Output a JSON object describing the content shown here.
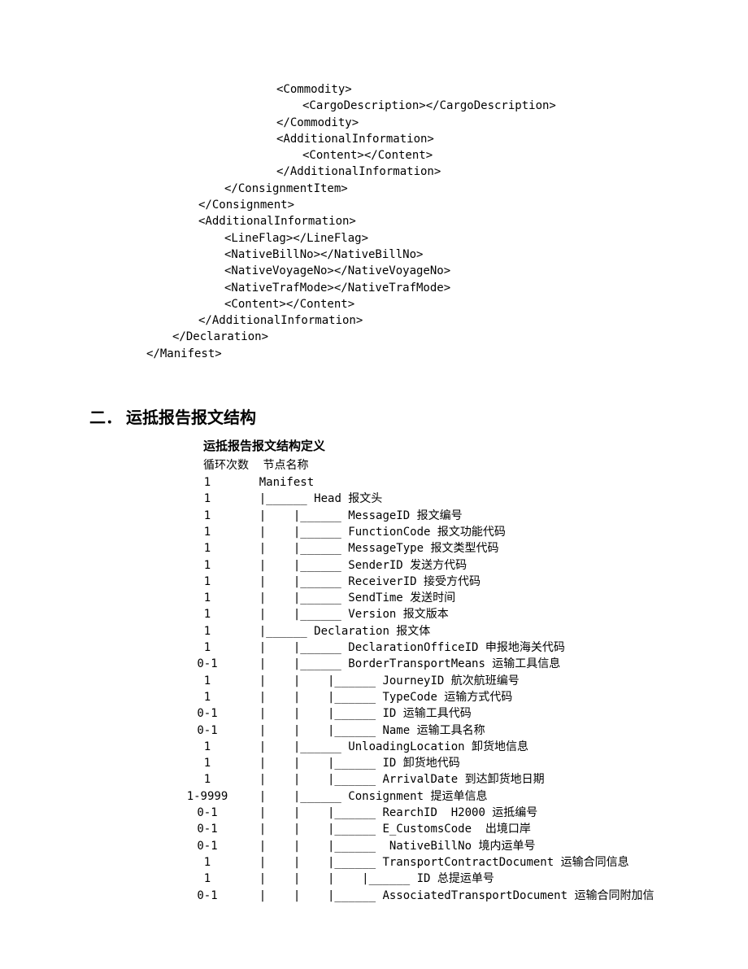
{
  "xml_lines": [
    {
      "indent": 5,
      "text": "<Commodity>"
    },
    {
      "indent": 6,
      "text": "<CargoDescription></CargoDescription>"
    },
    {
      "indent": 5,
      "text": "</Commodity>"
    },
    {
      "indent": 5,
      "text": "<AdditionalInformation>"
    },
    {
      "indent": 6,
      "text": "<Content></Content>"
    },
    {
      "indent": 5,
      "text": "</AdditionalInformation>"
    },
    {
      "indent": 3,
      "text": "</ConsignmentItem>"
    },
    {
      "indent": 2,
      "text": "</Consignment>"
    },
    {
      "indent": 2,
      "text": "<AdditionalInformation>"
    },
    {
      "indent": 3,
      "text": "<LineFlag></LineFlag>"
    },
    {
      "indent": 3,
      "text": "<NativeBillNo></NativeBillNo>"
    },
    {
      "indent": 3,
      "text": "<NativeVoyageNo></NativeVoyageNo>"
    },
    {
      "indent": 3,
      "text": "<NativeTrafMode></NativeTrafMode>"
    },
    {
      "indent": 3,
      "text": "<Content></Content>"
    },
    {
      "indent": 2,
      "text": "</AdditionalInformation>"
    },
    {
      "indent": 1,
      "text": "</Declaration>"
    },
    {
      "indent": 0,
      "text": "</Manifest>"
    }
  ],
  "section_heading": "二． 运抵报告报文结构",
  "sub_heading": "运抵报告报文结构定义",
  "tree_header": {
    "col1": "循环次数",
    "col2": "节点名称"
  },
  "tree_rows": [
    {
      "count": "1",
      "depth": 0,
      "label": "Manifest"
    },
    {
      "count": "1",
      "depth": 1,
      "label": "Head 报文头"
    },
    {
      "count": "1",
      "depth": 2,
      "label": "MessageID 报文编号"
    },
    {
      "count": "1",
      "depth": 2,
      "label": "FunctionCode 报文功能代码"
    },
    {
      "count": "1",
      "depth": 2,
      "label": "MessageType 报文类型代码"
    },
    {
      "count": "1",
      "depth": 2,
      "label": "SenderID 发送方代码"
    },
    {
      "count": "1",
      "depth": 2,
      "label": "ReceiverID 接受方代码"
    },
    {
      "count": "1",
      "depth": 2,
      "label": "SendTime 发送时间"
    },
    {
      "count": "1",
      "depth": 2,
      "label": "Version 报文版本"
    },
    {
      "count": "1",
      "depth": 1,
      "label": "Declaration 报文体"
    },
    {
      "count": "1",
      "depth": 2,
      "label": "DeclarationOfficeID 申报地海关代码"
    },
    {
      "count": "0-1",
      "depth": 2,
      "label": "BorderTransportMeans 运输工具信息"
    },
    {
      "count": "1",
      "depth": 3,
      "label": "JourneyID 航次航班编号"
    },
    {
      "count": "1",
      "depth": 3,
      "label": "TypeCode 运输方式代码"
    },
    {
      "count": "0-1",
      "depth": 3,
      "label": "ID 运输工具代码"
    },
    {
      "count": "0-1",
      "depth": 3,
      "label": "Name 运输工具名称"
    },
    {
      "count": "1",
      "depth": 2,
      "label": "UnloadingLocation 卸货地信息"
    },
    {
      "count": "1",
      "depth": 3,
      "label": "ID 卸货地代码"
    },
    {
      "count": "1",
      "depth": 3,
      "label": "ArrivalDate 到达卸货地日期"
    },
    {
      "count": "1-9999",
      "depth": 2,
      "label": "Consignment 提运单信息"
    },
    {
      "count": "0-1",
      "depth": 3,
      "label": "RearchID  H2000 运抵编号"
    },
    {
      "count": "0-1",
      "depth": 3,
      "label": "E_CustomsCode  出境口岸"
    },
    {
      "count": "0-1",
      "depth": 3,
      "label": " NativeBillNo 境内运单号"
    },
    {
      "count": "1",
      "depth": 3,
      "label": "TransportContractDocument 运输合同信息"
    },
    {
      "count": "1",
      "depth": 4,
      "label": "ID 总提运单号"
    },
    {
      "count": "0-1",
      "depth": 3,
      "label": "AssociatedTransportDocument 运输合同附加信"
    }
  ]
}
